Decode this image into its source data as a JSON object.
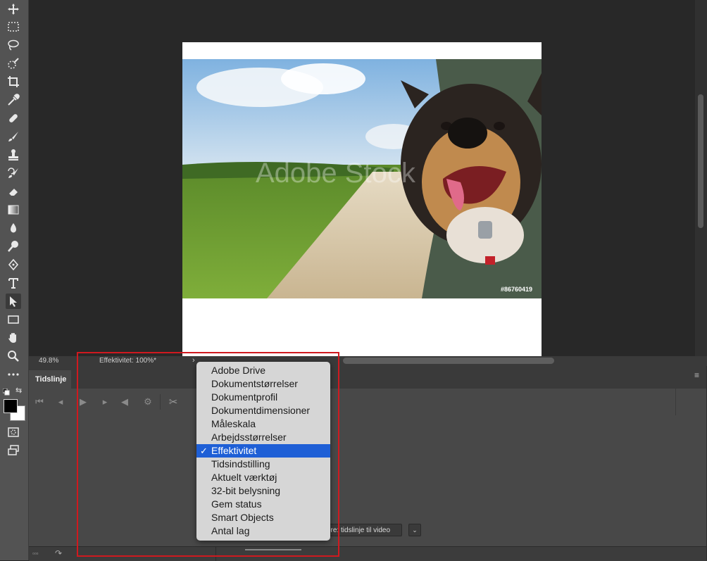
{
  "status_bar": {
    "zoom": "49.8%",
    "info": "Effektivitet: 100%*",
    "arrow": "›"
  },
  "timeline": {
    "tab_label": "Tidslinje",
    "render_button_label": "ore: tidslinje til video",
    "render_dropdown_icon": "⌄"
  },
  "photo": {
    "watermark": "Adobe Stock",
    "stock_id": "#86760419"
  },
  "status_menu": {
    "items": [
      {
        "label": "Adobe Drive",
        "selected": false
      },
      {
        "label": "Dokumentstørrelser",
        "selected": false
      },
      {
        "label": "Dokumentprofil",
        "selected": false
      },
      {
        "label": "Dokumentdimensioner",
        "selected": false
      },
      {
        "label": "Måleskala",
        "selected": false
      },
      {
        "label": "Arbejdsstørrelser",
        "selected": false
      },
      {
        "label": "Effektivitet",
        "selected": true
      },
      {
        "label": "Tidsindstilling",
        "selected": false
      },
      {
        "label": "Aktuelt værktøj",
        "selected": false
      },
      {
        "label": "32-bit belysning",
        "selected": false
      },
      {
        "label": "Gem status",
        "selected": false
      },
      {
        "label": "Smart Objects",
        "selected": false
      },
      {
        "label": "Antal lag",
        "selected": false
      }
    ],
    "check_glyph": "✓"
  },
  "colors": {
    "highlight": "#d0191f",
    "menu_selected": "#1e5fd6",
    "menu_background": "#d6d6d6"
  },
  "toolbar": {
    "tools": [
      "move-tool",
      "marquee-tool",
      "lasso-tool",
      "quick-select-tool",
      "crop-tool",
      "eyedropper-tool",
      "healing-brush-tool",
      "brush-tool",
      "clone-stamp-tool",
      "history-brush-tool",
      "eraser-tool",
      "gradient-tool",
      "blur-tool",
      "dodge-tool",
      "pen-tool",
      "type-tool",
      "path-select-tool",
      "rectangle-tool",
      "hand-tool",
      "zoom-tool",
      "more-tools"
    ],
    "active": "path-select-tool"
  }
}
